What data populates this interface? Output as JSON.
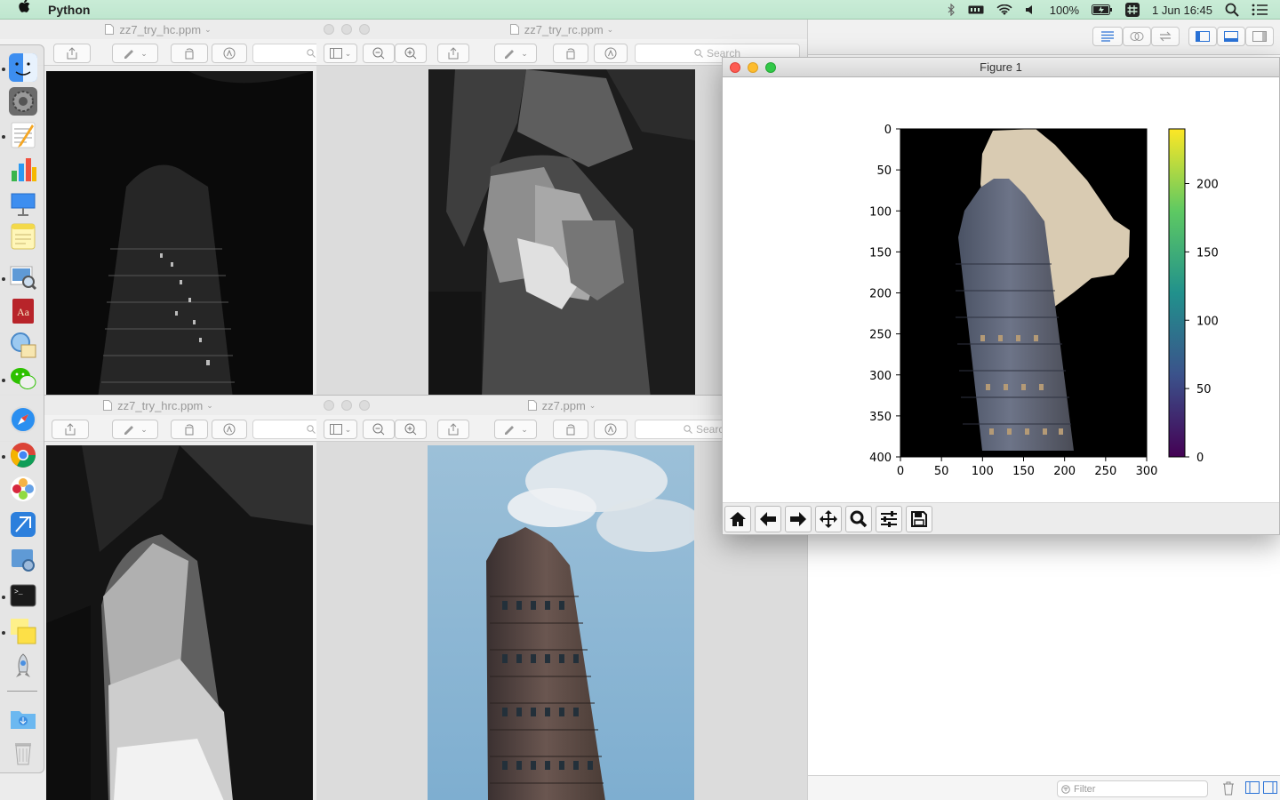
{
  "menubar": {
    "app_name": "Python",
    "battery": "100%",
    "date_time": "1 Jun  16:45"
  },
  "dock": {
    "items": [
      "finder-icon",
      "system-preferences-icon",
      "textedit-icon",
      "numbers-icon",
      "keynote-icon",
      "notes-icon",
      "preview-icon",
      "dictionary-icon",
      "script-editor-icon",
      "wechat-icon",
      "safari-icon",
      "chrome-icon",
      "photos-icon",
      "xcode-icon",
      "app-store-icon",
      "terminal-icon",
      "stickies-icon",
      "launchpad-icon",
      "downloads-folder-icon",
      "trash-icon"
    ]
  },
  "windows": {
    "hc": {
      "title": "zz7_try_hc.ppm"
    },
    "rc": {
      "title": "zz7_try_rc.ppm",
      "search_placeholder": "Search"
    },
    "hrc": {
      "title": "zz7_try_hrc.ppm"
    },
    "orig": {
      "title": "zz7.ppm",
      "search_placeholder": "Search"
    }
  },
  "figure": {
    "title": "Figure 1",
    "toolbar": [
      "home-icon",
      "back-arrow-icon",
      "forward-arrow-icon",
      "pan-icon",
      "zoom-icon",
      "configure-subplots-icon",
      "save-icon"
    ]
  },
  "chart_data": {
    "type": "heatmap",
    "x_ticks": [
      "0",
      "50",
      "100",
      "150",
      "200",
      "250",
      "300"
    ],
    "y_ticks": [
      "0",
      "50",
      "100",
      "150",
      "200",
      "250",
      "300",
      "350",
      "400"
    ],
    "xlim": [
      0,
      300
    ],
    "ylim": [
      400,
      0
    ],
    "colorbar": {
      "colormap": "viridis",
      "ticks": [
        "0",
        "50",
        "100",
        "150",
        "200"
      ],
      "range": [
        0,
        240
      ]
    }
  },
  "bgapp": {
    "filter_placeholder": "Filter"
  },
  "colors": {
    "menubar_bg": "#c9ecd6",
    "close": "#fd5c53",
    "minimize": "#fdbc2e",
    "zoom": "#32c848"
  }
}
